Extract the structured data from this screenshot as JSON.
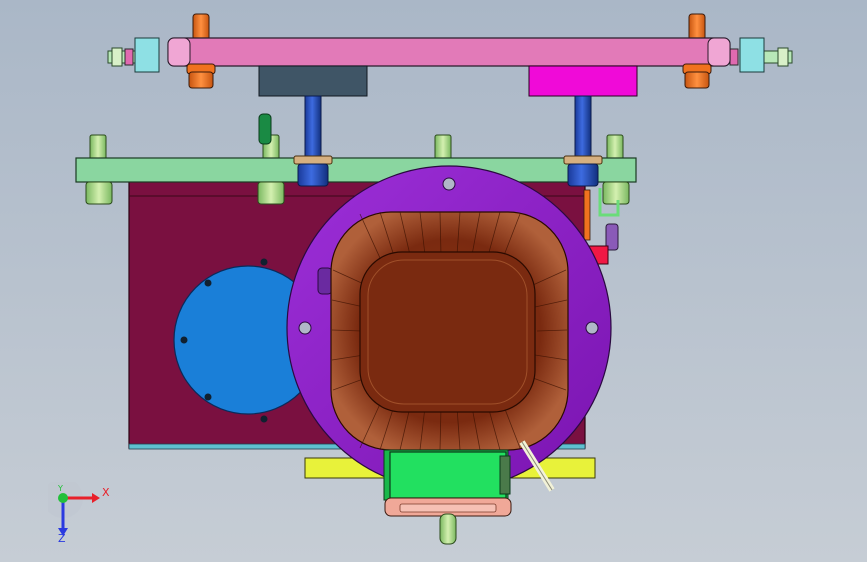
{
  "viewport": {
    "background_top": "#aab7c7",
    "background_bottom": "#c6cdd5"
  },
  "colors": {
    "top_bar": "#e27ab8",
    "mid_plate": "#8ad6a0",
    "housing": "#7a1040",
    "blue_cover": "#1a7fd8",
    "ring": "#8d1fc9",
    "coil": "#7a2a10",
    "green_box": "#22e060",
    "yellow_bar": "#e8f23a",
    "orange_post": "#f0721e",
    "shaft": "#1d47b8",
    "magenta_block": "#f00ad8",
    "slate_block": "#3f5566"
  },
  "triad": {
    "x_label": "X",
    "y_label": "Y",
    "z_label": "Z",
    "x_color": "#e8202a",
    "y_color": "#22c03a",
    "z_color": "#2a3ae0"
  }
}
